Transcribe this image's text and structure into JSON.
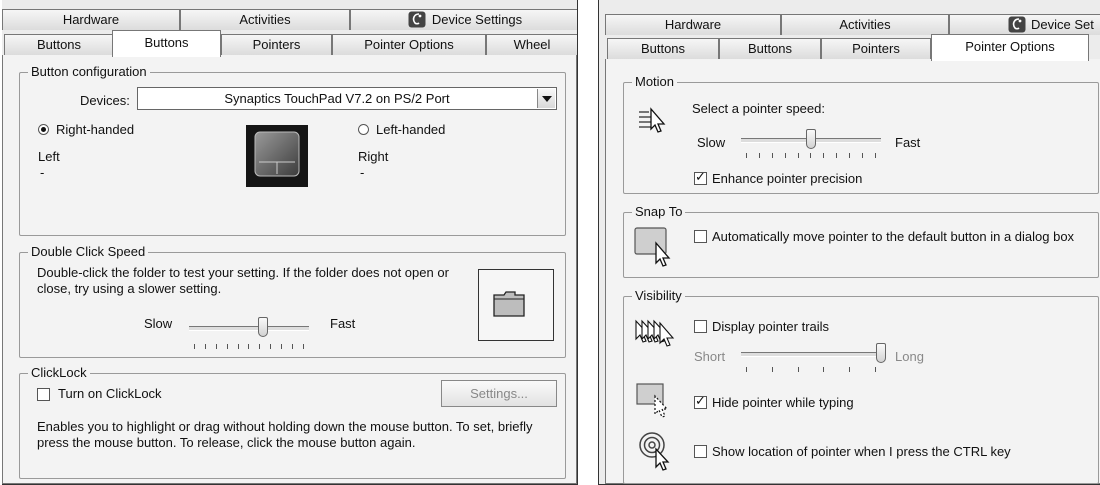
{
  "left": {
    "tabs_top": [
      "Hardware",
      "Activities",
      "Device Settings"
    ],
    "tabs_bottom": [
      "Buttons",
      "Buttons",
      "Pointers",
      "Pointer Options",
      "Wheel"
    ],
    "button_config": {
      "legend": "Button configuration",
      "devices_label": "Devices:",
      "device_value": "Synaptics TouchPad V7.2 on PS/2 Port",
      "right_handed": "Right-handed",
      "left_handed": "Left-handed",
      "left_label": "Left",
      "left_value": "-",
      "right_label": "Right",
      "right_value": "-",
      "right_handed_selected": true
    },
    "double_click": {
      "legend": "Double Click Speed",
      "description": "Double-click the folder to test your setting.  If the folder does not open or close, try using a slower setting.",
      "slow": "Slow",
      "fast": "Fast",
      "speed_level": 0.62
    },
    "clicklock": {
      "legend": "ClickLock",
      "checkbox_label": "Turn on ClickLock",
      "checked": false,
      "settings_button": "Settings...",
      "description": "Enables you to highlight or drag without holding down the mouse button.  To set, briefly press the mouse button.  To release, click the mouse button again."
    }
  },
  "right": {
    "tabs_top": [
      "Hardware",
      "Activities",
      "Device Set"
    ],
    "tabs_bottom": [
      "Buttons",
      "Buttons",
      "Pointers",
      "Pointer Options"
    ],
    "motion": {
      "legend": "Motion",
      "prompt": "Select a pointer speed:",
      "slow": "Slow",
      "fast": "Fast",
      "speed_level": 0.5,
      "enhance_label": "Enhance pointer precision",
      "enhance_checked": true
    },
    "snap": {
      "legend": "Snap To",
      "label": "Automatically move pointer to the default button in a dialog box",
      "checked": false
    },
    "visibility": {
      "legend": "Visibility",
      "trails_label": "Display pointer trails",
      "trails_checked": false,
      "short": "Short",
      "long": "Long",
      "trail_level": 1.0,
      "hide_label": "Hide pointer while typing",
      "hide_checked": true,
      "ctrl_label": "Show location of pointer when I press the CTRL key",
      "ctrl_checked": false
    }
  },
  "icons": [
    "device-settings-icon",
    "touchpad-icon",
    "folder-icon",
    "pointer-speed-icon",
    "snap-to-icon",
    "pointer-trails-icon",
    "hide-pointer-icon",
    "ctrl-locate-icon"
  ]
}
